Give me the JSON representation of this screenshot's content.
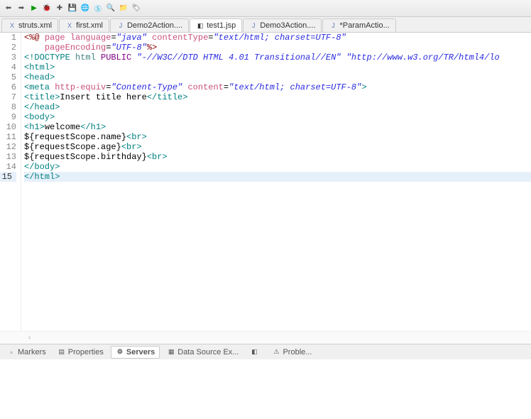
{
  "tabs": [
    {
      "icon": "X",
      "label": "struts.xml",
      "type": "xml"
    },
    {
      "icon": "X",
      "label": "first.xml",
      "type": "xml"
    },
    {
      "icon": "J",
      "label": "Demo2Action....",
      "type": "java"
    },
    {
      "icon": "◧",
      "label": "test1.jsp",
      "type": "jsp"
    },
    {
      "icon": "J",
      "label": "Demo3Action....",
      "type": "java"
    },
    {
      "icon": "J",
      "label": "*ParamActio...",
      "type": "java"
    }
  ],
  "lines": [
    {
      "n": "1",
      "html": "<span class='directive'>&lt;%@</span> <span class='attr-name'>page</span> <span class='attr-name'>language</span>=<span class='attr-val'>\"java\"</span> <span class='attr-name'>contentType</span>=<span class='attr-val'>\"text/html; charset=UTF-8\"</span>"
    },
    {
      "n": "2",
      "html": "    <span class='attr-name'>pageEncoding</span>=<span class='attr-val'>\"UTF-8\"</span><span class='directive'>%&gt;</span>"
    },
    {
      "n": "3",
      "html": "<span class='doctype'>&lt;!DOCTYPE</span> <span class='tag-name'>html</span> <span class='keyword'>PUBLIC</span> <span class='string'>\"-//W3C//DTD HTML 4.01 Transitional//EN\"</span> <span class='string'>\"http://www.w3.org/TR/html4/lo</span>"
    },
    {
      "n": "4",
      "html": "<span class='tag'>&lt;html&gt;</span>"
    },
    {
      "n": "5",
      "html": "<span class='tag'>&lt;head&gt;</span>"
    },
    {
      "n": "6",
      "html": "<span class='tag'>&lt;meta</span> <span class='attr-name'>http-equiv</span>=<span class='attr-val'>\"Content-Type\"</span> <span class='attr-name'>content</span>=<span class='attr-val'>\"text/html; charset=UTF-8\"</span><span class='tag'>&gt;</span>"
    },
    {
      "n": "7",
      "html": "<span class='tag'>&lt;title&gt;</span><span class='text'>Insert title here</span><span class='tag'>&lt;/title&gt;</span>"
    },
    {
      "n": "8",
      "html": "<span class='tag'>&lt;/head&gt;</span>"
    },
    {
      "n": "9",
      "html": "<span class='tag'>&lt;body&gt;</span>"
    },
    {
      "n": "10",
      "html": "<span class='tag'>&lt;h1&gt;</span><span class='text'>welcome</span><span class='tag'>&lt;/h1&gt;</span>"
    },
    {
      "n": "11",
      "html": "<span class='text'>${requestScope.name}</span><span class='tag'>&lt;br&gt;</span>"
    },
    {
      "n": "12",
      "html": "<span class='text'>${requestScope.age}</span><span class='tag'>&lt;br&gt;</span>"
    },
    {
      "n": "13",
      "html": "<span class='text'>${requestScope.birthday}</span><span class='tag'>&lt;br&gt;</span>"
    },
    {
      "n": "14",
      "html": "<span class='tag'>&lt;/body&gt;</span>"
    },
    {
      "n": "15",
      "html": "<span class='tag'>&lt;/html&gt;</span>",
      "current": true
    }
  ],
  "bottomTabs": [
    {
      "icon": "▫",
      "label": "Markers"
    },
    {
      "icon": "▤",
      "label": "Properties"
    },
    {
      "icon": "⚙",
      "label": "Servers",
      "active": true
    },
    {
      "icon": "▦",
      "label": "Data Source Ex..."
    },
    {
      "icon": "◧",
      "label": ""
    },
    {
      "icon": "⚠",
      "label": "Proble..."
    }
  ],
  "scroll": "‹"
}
